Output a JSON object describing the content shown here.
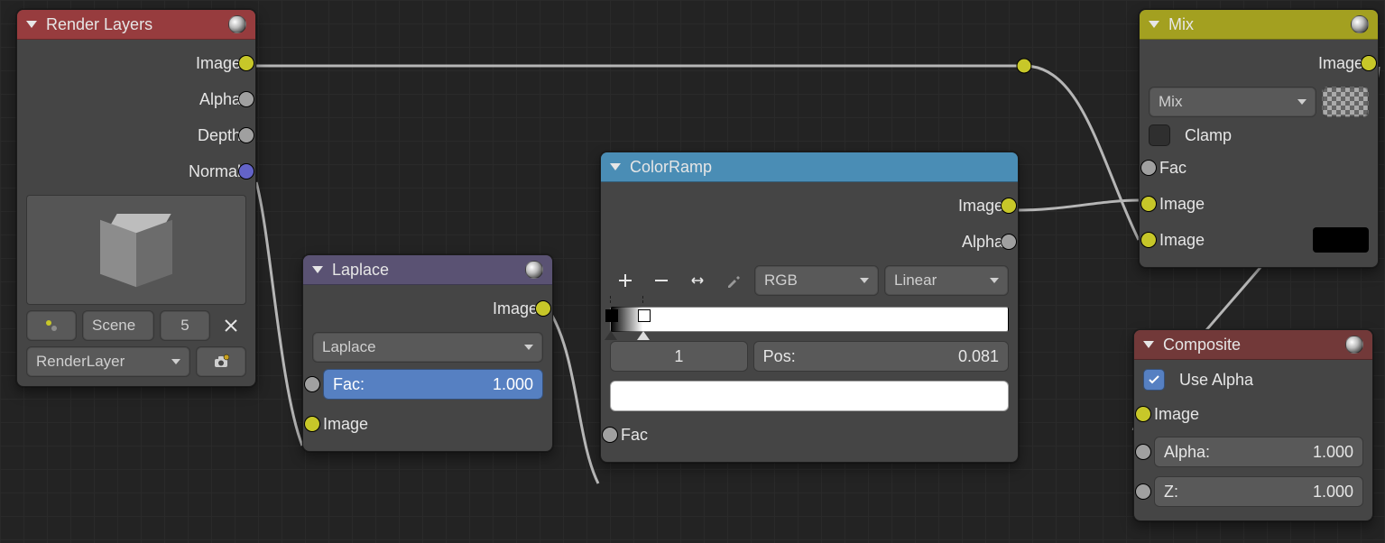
{
  "render_layers": {
    "title": "Render Layers",
    "outputs": {
      "image": "Image",
      "alpha": "Alpha",
      "depth": "Depth",
      "normal": "Normal"
    },
    "scene_label": "Scene",
    "scene_users": "5",
    "layer_name": "RenderLayer"
  },
  "laplace": {
    "title": "Laplace",
    "outputs": {
      "image": "Image"
    },
    "filter_type": "Laplace",
    "fac_label": "Fac:",
    "fac_value": "1.000",
    "inputs": {
      "image": "Image"
    }
  },
  "colorramp": {
    "title": "ColorRamp",
    "outputs": {
      "image": "Image",
      "alpha": "Alpha"
    },
    "mode": "RGB",
    "interp": "Linear",
    "active_index": "1",
    "pos_label": "Pos:",
    "pos_value": "0.081",
    "inputs": {
      "fac": "Fac"
    }
  },
  "mix": {
    "title": "Mix",
    "outputs": {
      "image": "Image"
    },
    "blend_type": "Mix",
    "clamp_label": "Clamp",
    "clamp_checked": false,
    "inputs": {
      "fac": "Fac",
      "image1": "Image",
      "image2": "Image"
    }
  },
  "composite": {
    "title": "Composite",
    "use_alpha_label": "Use Alpha",
    "use_alpha_checked": true,
    "inputs": {
      "image": "Image",
      "alpha_label": "Alpha:",
      "alpha_value": "1.000",
      "z_label": "Z:",
      "z_value": "1.000"
    }
  }
}
